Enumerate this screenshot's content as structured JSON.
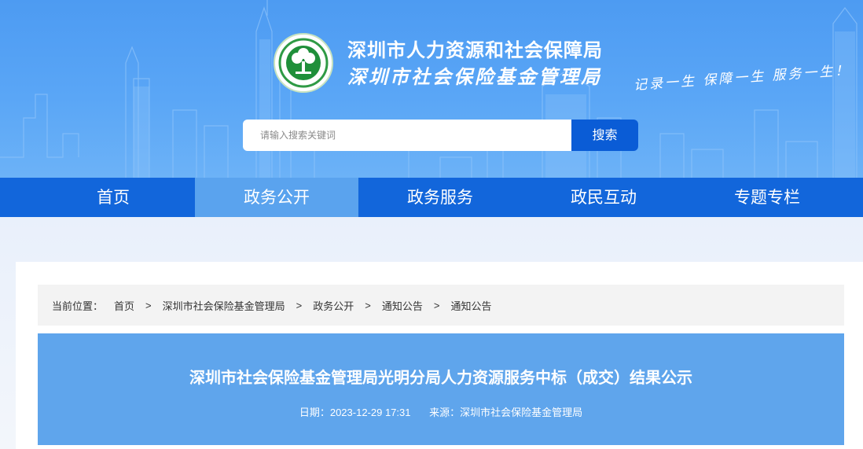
{
  "header": {
    "org_name": "深圳市人力资源和社会保障局",
    "org_name_2": "深圳市社会保险基金管理局",
    "slogan": "记录一生 保障一生 服务一生！",
    "emblem_icon": "tree-emblem-icon"
  },
  "search": {
    "placeholder": "请输入搜索关键词",
    "button_label": "搜索"
  },
  "nav": {
    "items": [
      {
        "label": "首页"
      },
      {
        "label": "政务公开"
      },
      {
        "label": "政务服务"
      },
      {
        "label": "政民互动"
      },
      {
        "label": "专题专栏"
      }
    ],
    "active": "政务公开"
  },
  "breadcrumb": {
    "prefix": "当前位置：",
    "items": [
      "首页",
      "深圳市社会保险基金管理局",
      "政务公开",
      "通知公告",
      "通知公告"
    ],
    "separator": ">"
  },
  "article": {
    "title": "深圳市社会保险基金管理局光明分局人力资源服务中标（成交）结果公示",
    "date": "日期：2023-12-29 17:31",
    "source": "来源：深圳市社会保险基金管理局"
  },
  "colors": {
    "header_blue": "#4d9bf2",
    "nav_blue": "#1266db",
    "nav_active": "#5aa3ee",
    "search_button": "#0a5cd6",
    "title_panel": "#5fa5ec"
  }
}
